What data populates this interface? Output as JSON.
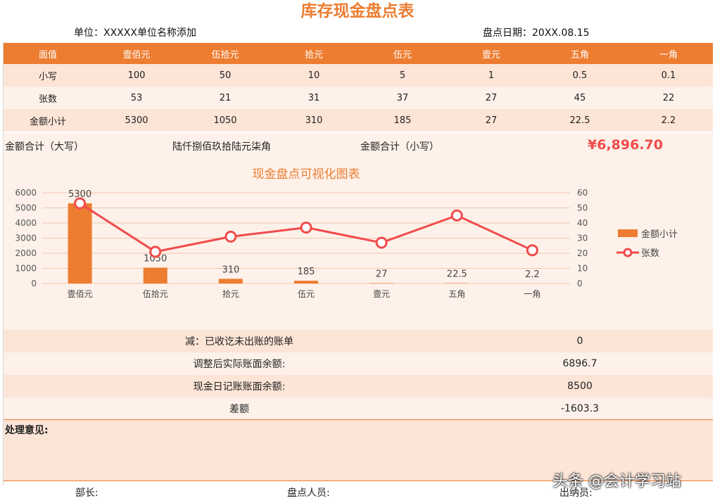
{
  "title": "库存现金盘点表",
  "unit_label": "单位：XXXXX单位名称添加",
  "date_label": "盘点日期：20XX.08.15",
  "table": {
    "header": [
      "面值",
      "壹佰元",
      "伍拾元",
      "拾元",
      "伍元",
      "壹元",
      "五角",
      "一角"
    ],
    "rows": [
      [
        "小写",
        "100",
        "50",
        "10",
        "5",
        "1",
        "0.5",
        "0.1"
      ],
      [
        "张数",
        "53",
        "21",
        "31",
        "37",
        "27",
        "45",
        "22"
      ],
      [
        "金额小计",
        "5300",
        "1050",
        "310",
        "185",
        "27",
        "22.5",
        "2.2"
      ]
    ]
  },
  "summary": {
    "upper_label": "金额合计（大写）",
    "upper_value": "陆仟捌佰玖拾陆元柒角",
    "lower_label": "金额合计（小写）",
    "lower_value": "¥6,896.70"
  },
  "colors": {
    "accent": "#ED7D31",
    "line": "#F14B4B"
  },
  "chart_data": {
    "type": "bar",
    "title": "现金盘点可视化图表",
    "categories": [
      "壹佰元",
      "伍拾元",
      "拾元",
      "伍元",
      "壹元",
      "五角",
      "一角"
    ],
    "series": [
      {
        "name": "金额小计",
        "type": "bar",
        "axis": "left",
        "values": [
          5300,
          1050,
          310,
          185,
          27,
          22.5,
          2.2
        ],
        "data_labels": [
          "5300",
          "1050",
          "310",
          "185",
          "27",
          "22.5",
          "2.2"
        ]
      },
      {
        "name": "张数",
        "type": "line",
        "axis": "right",
        "values": [
          53,
          21,
          31,
          37,
          27,
          45,
          22
        ]
      }
    ],
    "y_left": {
      "min": 0,
      "max": 6000,
      "ticks": [
        0,
        1000,
        2000,
        3000,
        4000,
        5000,
        6000
      ]
    },
    "y_right": {
      "min": 0,
      "max": 60,
      "ticks": [
        0,
        10,
        20,
        30,
        40,
        50,
        60
      ]
    },
    "legend_position": "right",
    "grid": true
  },
  "bottom_rows": [
    {
      "label": "减：已收讫未出账的账单",
      "value": "0"
    },
    {
      "label": "调整后实际账面余额:",
      "value": "6896.7"
    },
    {
      "label": "现金日记账账面余额:",
      "value": "8500"
    },
    {
      "label": "差额",
      "value": "-1603.3"
    }
  ],
  "remarks_label": "处理意见:",
  "footer": {
    "head": "部长:",
    "counter": "盘点人员:",
    "cashier": "出纳员:"
  },
  "watermark": "头条 @会计学习站"
}
